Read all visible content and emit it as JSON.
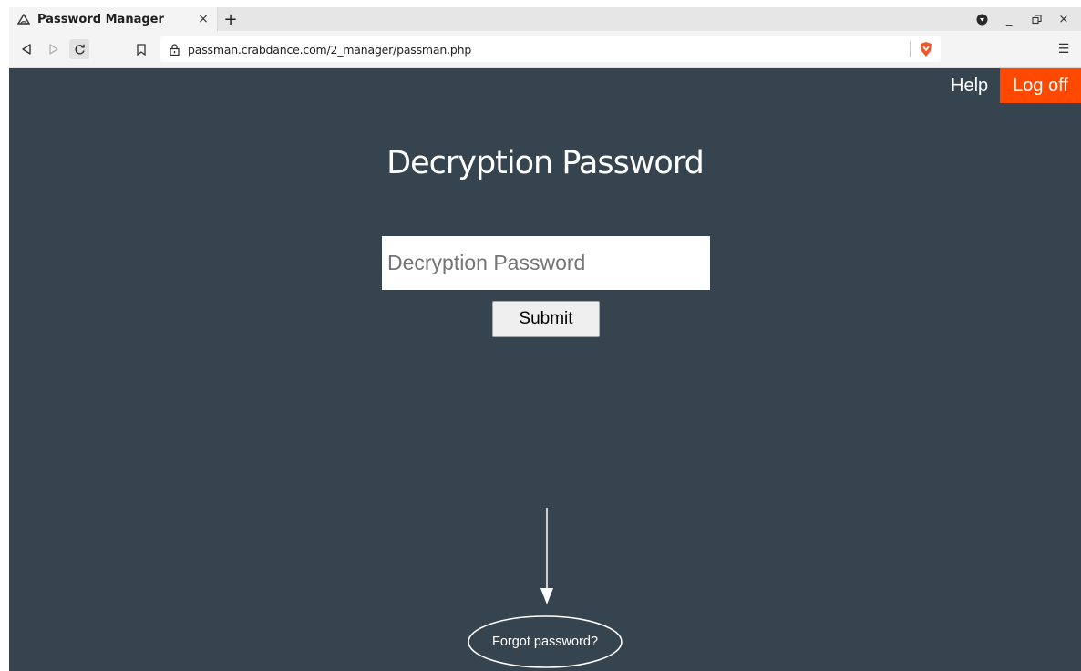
{
  "browser": {
    "tab": {
      "title": "Password Manager",
      "icon": "cloud-icon",
      "close_glyph": "×"
    },
    "new_tab_glyph": "+",
    "window_controls": {
      "minimize_glyph": "_",
      "close_glyph": "×"
    },
    "url": "passman.crabdance.com/2_manager/passman.php",
    "menu_glyph": "☰"
  },
  "nav": {
    "help_label": "Help",
    "logoff_label": "Log off"
  },
  "main": {
    "title": "Decryption Password",
    "password_placeholder": "Decryption Password",
    "submit_label": "Submit",
    "forgot_label": "Forgot password?"
  },
  "colors": {
    "page_background": "#36444f",
    "logoff_background": "#ff4800",
    "text": "#ffffff",
    "brave_shield": "#f1562b"
  }
}
